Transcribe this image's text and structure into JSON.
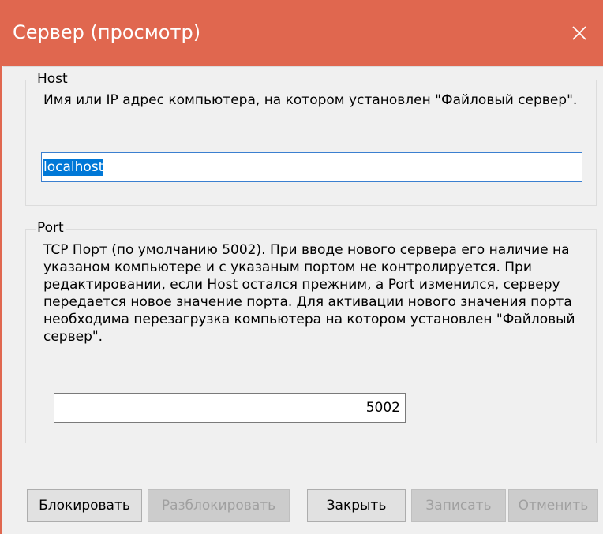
{
  "window": {
    "title": "Сервер (просмотр)",
    "accent_color": "#e0674f",
    "close_icon": "close-icon"
  },
  "host_group": {
    "legend": "Host",
    "description": "Имя или IP адрес компьютера, на котором установлен \"Файловый сервер\".",
    "value": "localhost"
  },
  "port_group": {
    "legend": "Port",
    "description": "TCP Порт (по умолчанию 5002). При вводе нового сервера его наличие на указаном компьютере и с указаным портом не контролируется. При редактировании, если Host остался прежним, а Port изменился, серверу передается новое значение порта. Для активации нового значения порта необходима перезагрузка компьютера на котором установлен \"Файловый сервер\".",
    "value": "5002"
  },
  "buttons": {
    "block": "Блокировать",
    "unblock": "Разблокировать",
    "close": "Закрыть",
    "save": "Записать",
    "cancel": "Отменить"
  }
}
